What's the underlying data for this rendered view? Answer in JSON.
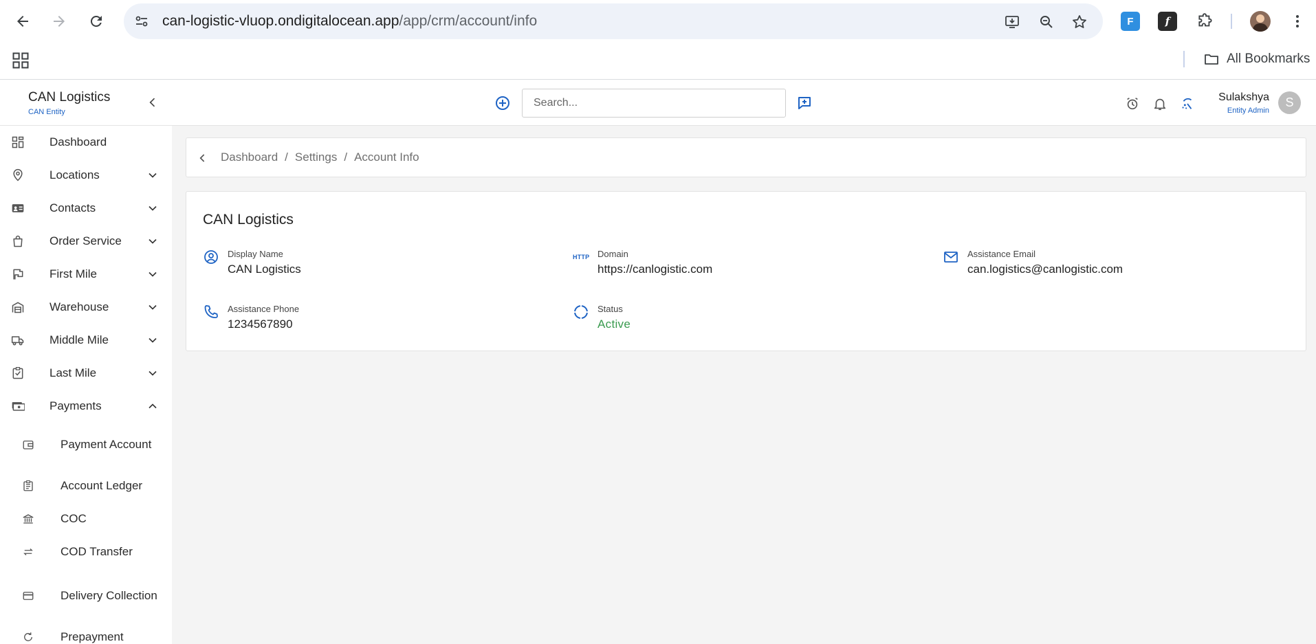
{
  "browser": {
    "url_host": "can-logistic-vluop.ondigitalocean.app",
    "url_path": "/app/crm/account/info",
    "all_bookmarks_label": "All Bookmarks",
    "icons": [
      "back-arrow-icon",
      "forward-arrow-icon",
      "reload-icon",
      "site-info-icon",
      "install-app-icon",
      "zoom-icon",
      "bookmark-star-icon",
      "extension-icon",
      "puzzle-icon",
      "profile-avatar",
      "kebab-menu-icon",
      "apps-grid-icon",
      "folder-icon"
    ]
  },
  "header": {
    "brand_name": "CAN Logistics",
    "brand_sub": "CAN Entity",
    "search_placeholder": "Search...",
    "user_name": "Sulakshya",
    "user_role": "Entity Admin",
    "avatar_initial": "S",
    "accent_color": "#1e63c4"
  },
  "sidebar": {
    "items": [
      {
        "label": "Dashboard",
        "icon": "dashboard-icon",
        "expandable": false
      },
      {
        "label": "Locations",
        "icon": "location-pin-icon",
        "expandable": true
      },
      {
        "label": "Contacts",
        "icon": "contact-card-icon",
        "expandable": true
      },
      {
        "label": "Order Service",
        "icon": "shopping-bag-icon",
        "expandable": true
      },
      {
        "label": "First Mile",
        "icon": "flag-icon",
        "expandable": true
      },
      {
        "label": "Warehouse",
        "icon": "warehouse-icon",
        "expandable": true
      },
      {
        "label": "Middle Mile",
        "icon": "truck-icon",
        "expandable": true
      },
      {
        "label": "Last Mile",
        "icon": "checklist-icon",
        "expandable": true
      },
      {
        "label": "Payments",
        "icon": "payments-icon",
        "expandable": true,
        "expanded": true
      }
    ],
    "payments_sub": [
      {
        "label": "Payment Account",
        "icon": "wallet-icon"
      },
      {
        "label": "Account Ledger",
        "icon": "ledger-icon"
      },
      {
        "label": "COC",
        "icon": "bank-icon"
      },
      {
        "label": "COD Transfer",
        "icon": "transfer-arrows-icon"
      },
      {
        "label": "Delivery Collection",
        "icon": "credit-card-icon"
      },
      {
        "label": "Prepayment",
        "icon": "refresh-coin-icon"
      }
    ]
  },
  "breadcrumb": {
    "items": [
      "Dashboard",
      "Settings",
      "Account Info"
    ],
    "separator": "/"
  },
  "account": {
    "title": "CAN Logistics",
    "fields": {
      "display_name": {
        "label": "Display Name",
        "value": "CAN Logistics",
        "icon": "user-circle-icon"
      },
      "domain": {
        "label": "Domain",
        "value": "https://canlogistic.com",
        "icon": "http-icon",
        "icon_text": "HTTP"
      },
      "assistance_email": {
        "label": "Assistance Email",
        "value": "can.logistics@canlogistic.com",
        "icon": "mail-icon"
      },
      "assistance_phone": {
        "label": "Assistance Phone",
        "value": "1234567890",
        "icon": "phone-icon"
      },
      "status": {
        "label": "Status",
        "value": "Active",
        "icon": "status-ring-icon",
        "color": "#3a9b4f"
      }
    }
  }
}
